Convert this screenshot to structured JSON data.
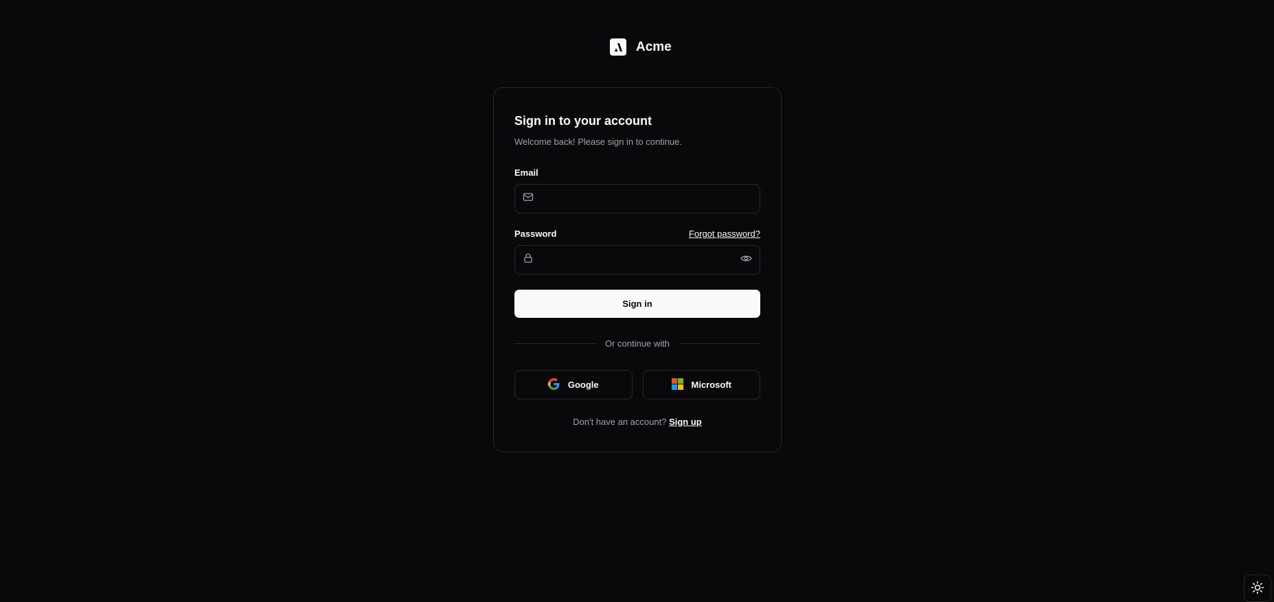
{
  "brand": {
    "name": "Acme"
  },
  "card": {
    "title": "Sign in to your account",
    "subtitle": "Welcome back! Please sign in to continue.",
    "email": {
      "label": "Email",
      "value": ""
    },
    "password": {
      "label": "Password",
      "value": "",
      "forgot_label": "Forgot password?"
    },
    "submit_label": "Sign in",
    "divider_label": "Or continue with",
    "social": [
      {
        "label": "Google"
      },
      {
        "label": "Microsoft"
      }
    ],
    "signup_prompt": "Don't have an account?",
    "signup_label": "Sign up"
  },
  "colors": {
    "background": "#09090b",
    "border": "#27272a",
    "muted": "#a1a1aa",
    "primary": "#fafafa"
  }
}
